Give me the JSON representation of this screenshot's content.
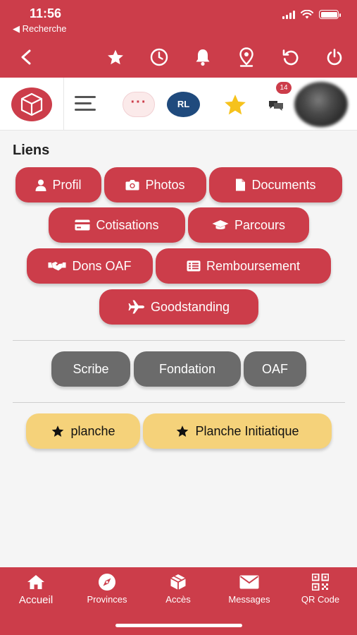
{
  "status_bar": {
    "time": "11:56",
    "back_label": "◀ Recherche"
  },
  "toolbar": {
    "icons": [
      "back-chevron",
      "star",
      "clock",
      "bell",
      "location-pin",
      "refresh",
      "power"
    ]
  },
  "header": {
    "more_label": "···",
    "rl_label": "RL",
    "message_count": "14"
  },
  "section": {
    "title": "Liens"
  },
  "links": {
    "profil": "Profil",
    "photos": "Photos",
    "documents": "Documents",
    "cotisations": "Cotisations",
    "parcours": "Parcours",
    "dons": "Dons OAF",
    "remboursement": "Remboursement",
    "goodstanding": "Goodstanding"
  },
  "secondary": {
    "scribe": "Scribe",
    "fondation": "Fondation",
    "oaf": "OAF"
  },
  "favorites": {
    "planche": "planche",
    "planche_initiatique": "Planche Initiatique"
  },
  "tabs": {
    "accueil": "Accueil",
    "provinces": "Provinces",
    "acces": "Accès",
    "messages": "Messages",
    "qr": "QR Code"
  },
  "colors": {
    "brand_red": "#cc3d4a",
    "gray_button": "#6b6b6b",
    "favorite_yellow": "#f5d27a",
    "rl_blue": "#1f4a7d"
  }
}
